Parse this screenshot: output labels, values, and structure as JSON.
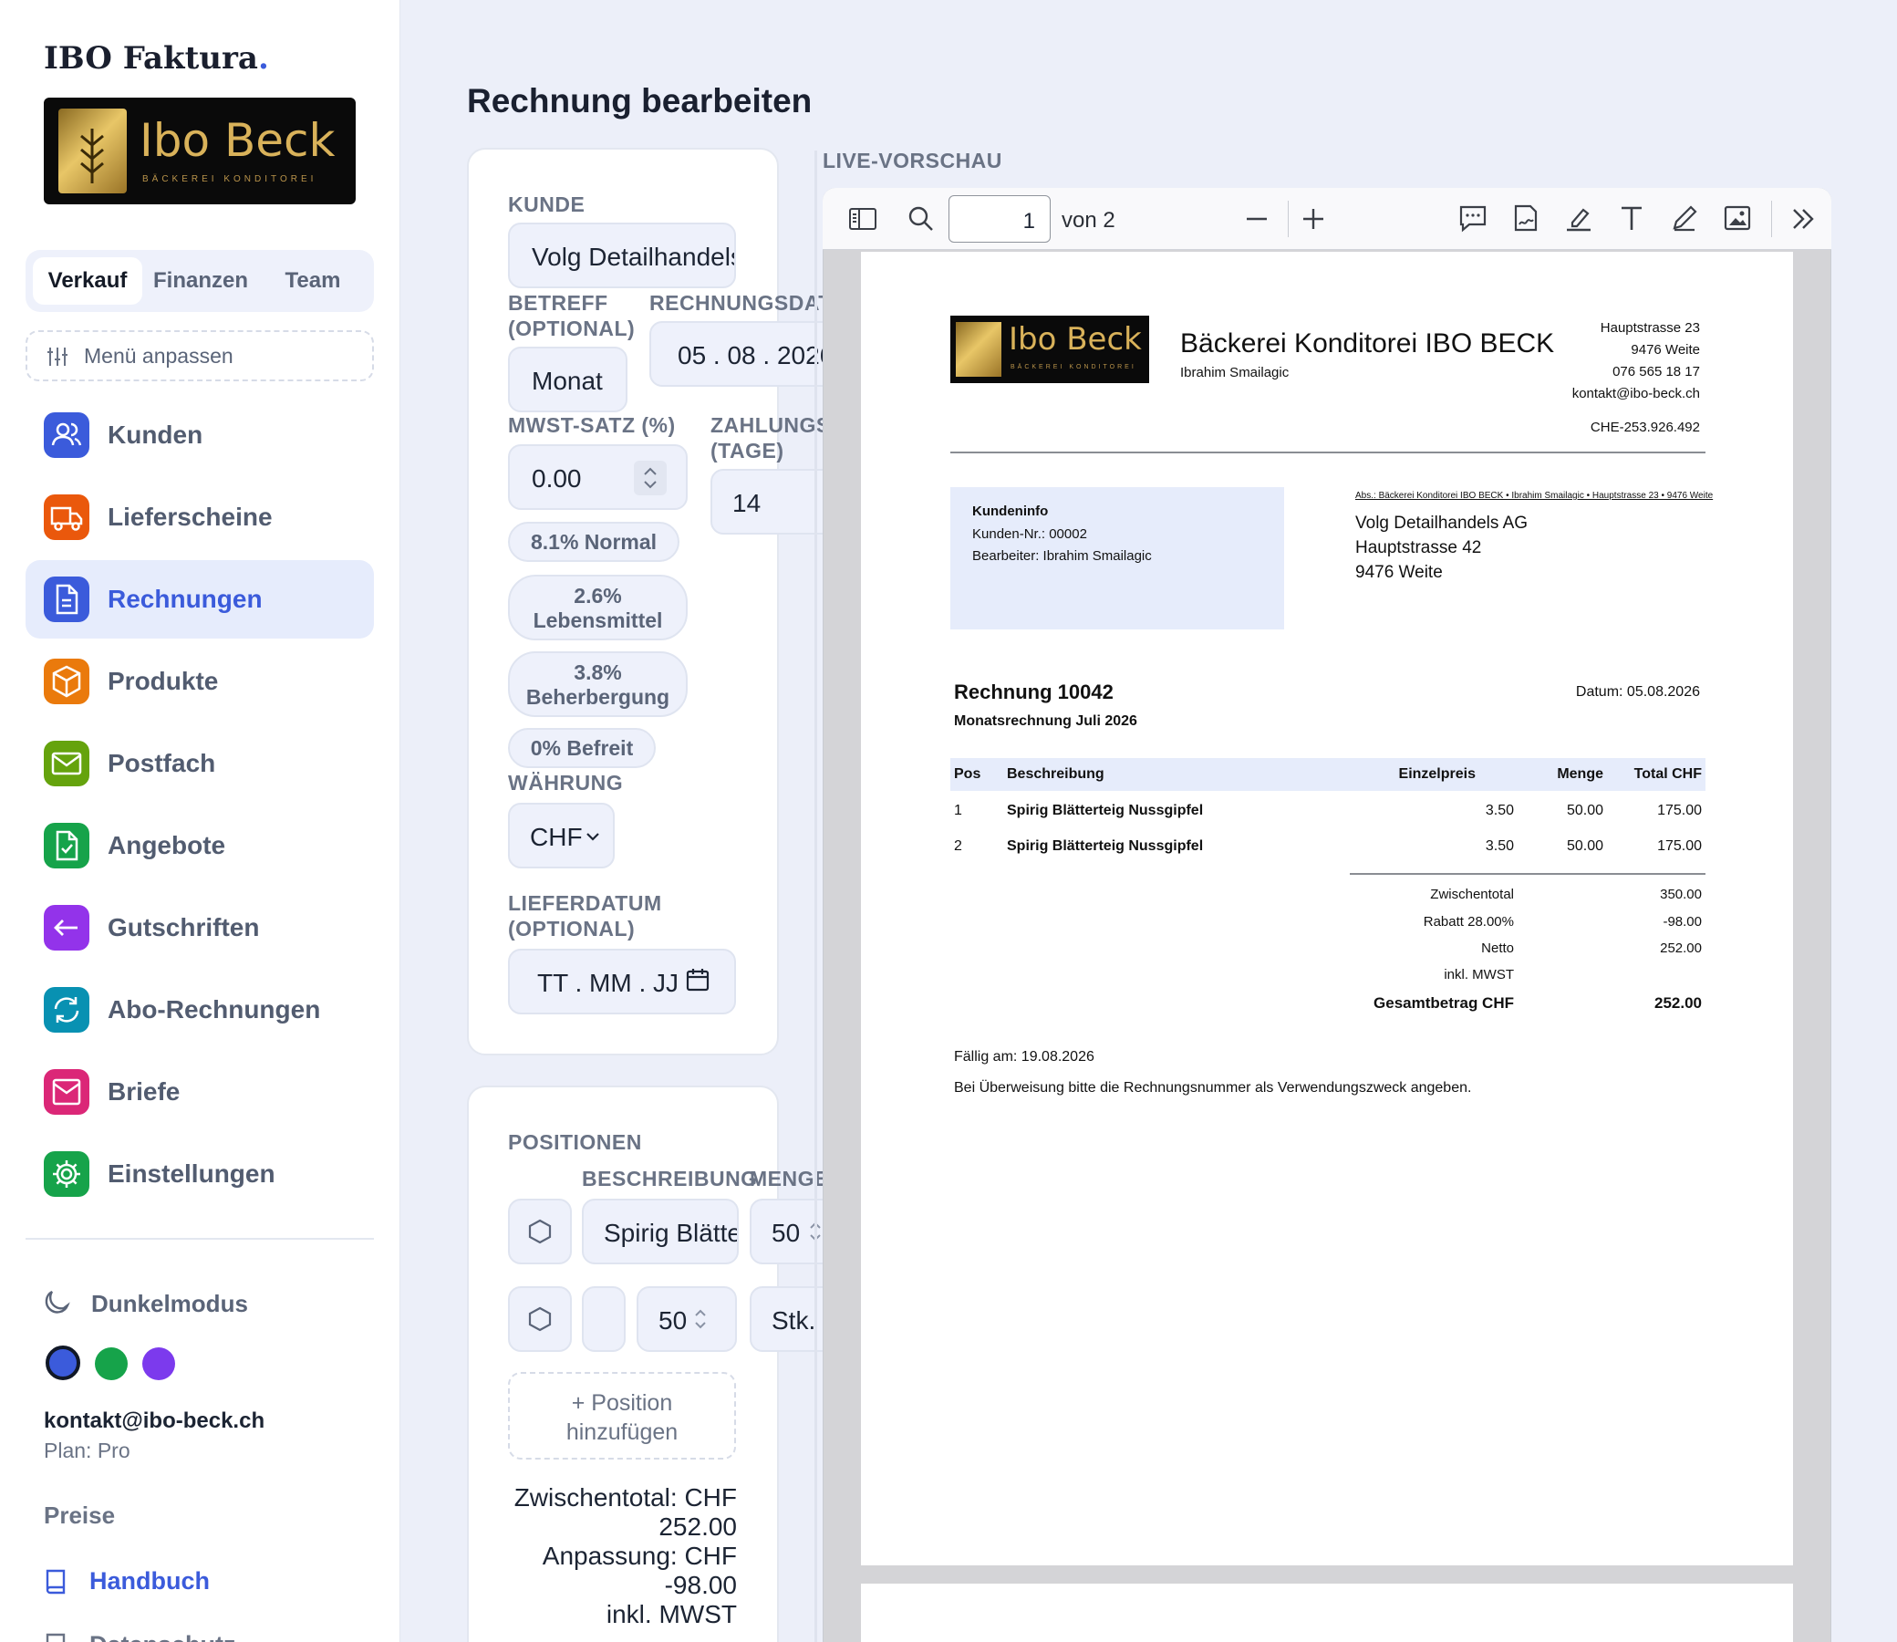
{
  "sidebar": {
    "brand": "IBO Faktura",
    "brand_dot": ".",
    "logo_text": "Ibo Beck",
    "logo_sub": "BÄCKEREI KONDITOREI",
    "tabs": [
      "Verkauf",
      "Finanzen",
      "Team"
    ],
    "customize": "Menü anpassen",
    "nav": [
      {
        "label": "Kunden",
        "icon": "users-icon",
        "color": "#3b5bdb"
      },
      {
        "label": "Lieferscheine",
        "icon": "truck-icon",
        "color": "#ea580c"
      },
      {
        "label": "Rechnungen",
        "icon": "document-icon",
        "color": "#3b5bdb"
      },
      {
        "label": "Produkte",
        "icon": "box-icon",
        "color": "#ea7a0c"
      },
      {
        "label": "Postfach",
        "icon": "mail-icon",
        "color": "#65a30d"
      },
      {
        "label": "Angebote",
        "icon": "document-check-icon",
        "color": "#16a34a"
      },
      {
        "label": "Gutschriften",
        "icon": "arrow-left-icon",
        "color": "#9333ea"
      },
      {
        "label": "Abo-Rechnungen",
        "icon": "refresh-icon",
        "color": "#0891b2"
      },
      {
        "label": "Briefe",
        "icon": "envelope-icon",
        "color": "#db2777"
      },
      {
        "label": "Einstellungen",
        "icon": "gear-icon",
        "color": "#16a34a"
      }
    ],
    "dark_mode": "Dunkelmodus",
    "theme_colors": [
      "#3b5bdb",
      "#16a34a",
      "#7c3aed"
    ],
    "user_email": "kontakt@ibo-beck.ch",
    "plan": "Plan: Pro",
    "prices": "Preise",
    "manual": "Handbuch",
    "privacy": "Datenschutz"
  },
  "page": {
    "title": "Rechnung bearbeiten",
    "preview_label": "LIVE-VORSCHAU"
  },
  "form": {
    "kunde_label": "KUNDE",
    "kunde_value": "Volg Detailhandels AG",
    "betreff_label": "BETREFF (OPTIONAL)",
    "betreff_value": "Monat",
    "rechnungsdatum_label": "RECHNUNGSDATUM",
    "rechnungsdatum_value": "05 . 08 . 2026",
    "mwst_label": "MWST-SATZ (%)",
    "mwst_value": "0.00",
    "zahlung_label": "ZAHLUNGSZIEL (TAGE)",
    "zahlung_value": "14",
    "vat_chips": [
      "8.1% Normal",
      "2.6% Lebensmittel",
      "3.8% Beherbergung",
      "0% Befreit"
    ],
    "waehrung_label": "WÄHRUNG",
    "waehrung_value": "CHF",
    "lieferdatum_label": "LIEFERDATUM (OPTIONAL)",
    "lieferdatum_placeholder": "TT . MM . JJ"
  },
  "positions": {
    "title": "POSITIONEN",
    "col_desc": "BESCHREIBUNG",
    "col_qty": "MENGE",
    "row1_desc": "Spirig Blätterteig Nussgipfel",
    "row1_qty": "50",
    "row2_qty": "50",
    "row2_unit": "Stk.",
    "add_label": "+ Position hinzufügen",
    "sum_lines": [
      "Zwischentotal: CHF",
      "252.00",
      "Anpassung: CHF",
      "-98.00",
      "inkl. MWST"
    ]
  },
  "viewer": {
    "page_input": "1",
    "page_count": "von 2"
  },
  "invoice": {
    "logo_text": "Ibo Beck",
    "logo_sub": "BÄCKEREI KONDITOREI",
    "company": "Bäckerei Konditorei IBO BECK",
    "owner": "Ibrahim Smailagic",
    "address": [
      "Hauptstrasse 23",
      "9476 Weite",
      "076 565 18 17",
      "kontakt@ibo-beck.ch"
    ],
    "uid": "CHE-253.926.492",
    "info_title": "Kundeninfo",
    "info_lines": [
      "Kunden-Nr.: 00002",
      "Bearbeiter: Ibrahim Smailagic"
    ],
    "sender_line": "Abs.: Bäckerei Konditorei IBO BECK • Ibrahim Smailagic • Hauptstrasse 23 • 9476 Weite",
    "recipient": [
      "Volg Detailhandels AG",
      "Hauptstrasse 42",
      "9476 Weite"
    ],
    "title": "Rechnung 10042",
    "subtitle": "Monatsrechnung Juli 2026",
    "date": "Datum: 05.08.2026",
    "table_headers": [
      "Pos",
      "Beschreibung",
      "Einzelpreis",
      "Menge",
      "Total CHF"
    ],
    "rows": [
      [
        "1",
        "Spirig Blätterteig Nussgipfel",
        "3.50",
        "50.00",
        "175.00"
      ],
      [
        "2",
        "Spirig Blätterteig Nussgipfel",
        "3.50",
        "50.00",
        "175.00"
      ]
    ],
    "totals": [
      [
        "Zwischentotal",
        "350.00"
      ],
      [
        "Rabatt 28.00%",
        "-98.00"
      ],
      [
        "Netto",
        "252.00"
      ],
      [
        "inkl. MWST",
        ""
      ]
    ],
    "grand_label": "Gesamtbetrag CHF",
    "grand_value": "252.00",
    "due": "Fällig am: 19.08.2026",
    "note": "Bei Überweisung bitte die Rechnungsnummer als Verwendungszweck angeben."
  }
}
